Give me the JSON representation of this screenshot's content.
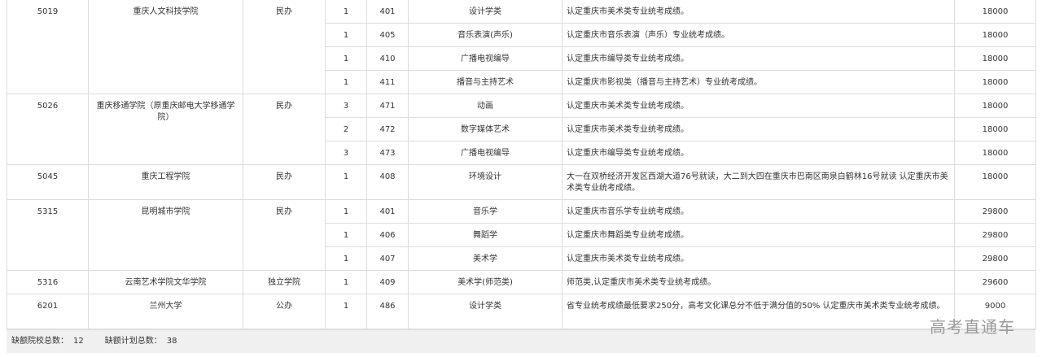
{
  "rows": [
    {
      "code": "5019",
      "school": "重庆人文科技学院",
      "type": "民办",
      "plan": "1",
      "major_code": "401",
      "major": "设计学类",
      "note": "认定重庆市美术类专业统考成绩。",
      "fee": "18000"
    },
    {
      "plan": "1",
      "major_code": "405",
      "major": "音乐表演(声乐)",
      "note": "认定重庆市音乐表演（声乐）专业统考成绩。",
      "fee": "18000"
    },
    {
      "plan": "1",
      "major_code": "410",
      "major": "广播电视编导",
      "note": "认定重庆市编导类专业统考成绩。",
      "fee": "18000"
    },
    {
      "plan": "1",
      "major_code": "411",
      "major": "播音与主持艺术",
      "note": "认定重庆市影视类（播音与主持艺术）专业统考成绩。",
      "fee": "18000"
    },
    {
      "code": "5026",
      "school": "重庆移通学院（原重庆邮电大学移通学院）",
      "type": "民办",
      "plan": "3",
      "major_code": "471",
      "major": "动画",
      "note": "认定重庆市美术类专业统考成绩。",
      "fee": "18000"
    },
    {
      "plan": "2",
      "major_code": "472",
      "major": "数字媒体艺术",
      "note": "认定重庆市美术类专业统考成绩。",
      "fee": "18000"
    },
    {
      "plan": "3",
      "major_code": "473",
      "major": "广播电视编导",
      "note": "认定重庆市编导类专业统考成绩。",
      "fee": "18000"
    },
    {
      "code": "5045",
      "school": "重庆工程学院",
      "type": "民办",
      "plan": "1",
      "major_code": "408",
      "major": "环境设计",
      "note": "大一在双桥经济开发区西湖大道76号就读，大二到大四在重庆市巴南区南泉白鹤林16号就读 认定重庆市美术类专业统考成绩。",
      "fee": "18000"
    },
    {
      "code": "5315",
      "school": "昆明城市学院",
      "type": "民办",
      "plan": "1",
      "major_code": "401",
      "major": "音乐学",
      "note": "认定重庆市音乐学专业统考成绩。",
      "fee": "29800"
    },
    {
      "plan": "1",
      "major_code": "406",
      "major": "舞蹈学",
      "note": "认定重庆市舞蹈类专业统考成绩。",
      "fee": "29800"
    },
    {
      "plan": "1",
      "major_code": "407",
      "major": "美术学",
      "note": "认定重庆市美术类专业统考成绩。",
      "fee": "29800"
    },
    {
      "code": "5316",
      "school": "云南艺术学院文华学院",
      "type": "独立学院",
      "plan": "1",
      "major_code": "409",
      "major": "美术学(师范类)",
      "note": "师范类,认定重庆市美术类专业统考成绩。",
      "fee": "29600"
    },
    {
      "code": "6201",
      "school": "兰州大学",
      "type": "公办",
      "plan": "1",
      "major_code": "486",
      "major": "设计学类",
      "note": "省专业统考成绩最低要求250分，高考文化课总分不低于满分值的50% 认定重庆市美术类专业统考成绩。",
      "fee": "9000"
    }
  ],
  "footer": {
    "schools_label": "缺额院校总数：",
    "schools_value": "12",
    "plan_label": "缺额计划总数：",
    "plan_value": "38"
  },
  "watermark": "高考直通车"
}
